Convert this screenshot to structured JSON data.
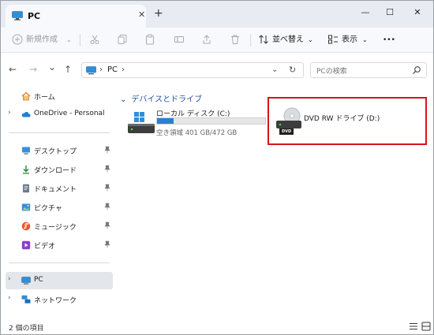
{
  "window": {
    "tab_title": "PC",
    "tab_close": "✕",
    "new_tab": "+",
    "minimize": "—",
    "maximize": "☐",
    "close": "✕"
  },
  "toolbar": {
    "new_label": "新規作成",
    "sort_label": "並べ替え",
    "view_label": "表示",
    "more_label": "•••"
  },
  "address": {
    "crumb_arrow": "›",
    "crumb_pc": "PC",
    "crumb_arrow2": "›",
    "chevron": "⌄",
    "refresh": "↻",
    "search_placeholder": "PCの検索"
  },
  "nav_buttons": {
    "back": "←",
    "forward": "→",
    "recent": "⌄",
    "up": "↑"
  },
  "sidebar": {
    "items": [
      {
        "label": "ホーム"
      },
      {
        "label": "OneDrive - Personal"
      },
      {
        "label": "デスクトップ"
      },
      {
        "label": "ダウンロード"
      },
      {
        "label": "ドキュメント"
      },
      {
        "label": "ピクチャ"
      },
      {
        "label": "ミュージック"
      },
      {
        "label": "ビデオ"
      },
      {
        "label": "PC"
      },
      {
        "label": "ネットワーク"
      }
    ],
    "expander": "›"
  },
  "content": {
    "group_title": "デバイスとドライブ",
    "group_caret": "⌄",
    "drives": [
      {
        "name": "ローカル ディスク (C:)",
        "free_text": "空き領域 401 GB/472 GB",
        "used_fraction": 0.15
      },
      {
        "name": "DVD RW ドライブ (D:)",
        "badge": "DVD"
      }
    ]
  },
  "status": {
    "item_count": "2 個の項目"
  },
  "colors": {
    "accent": "#2a7fd4",
    "highlight": "#d6141c"
  }
}
